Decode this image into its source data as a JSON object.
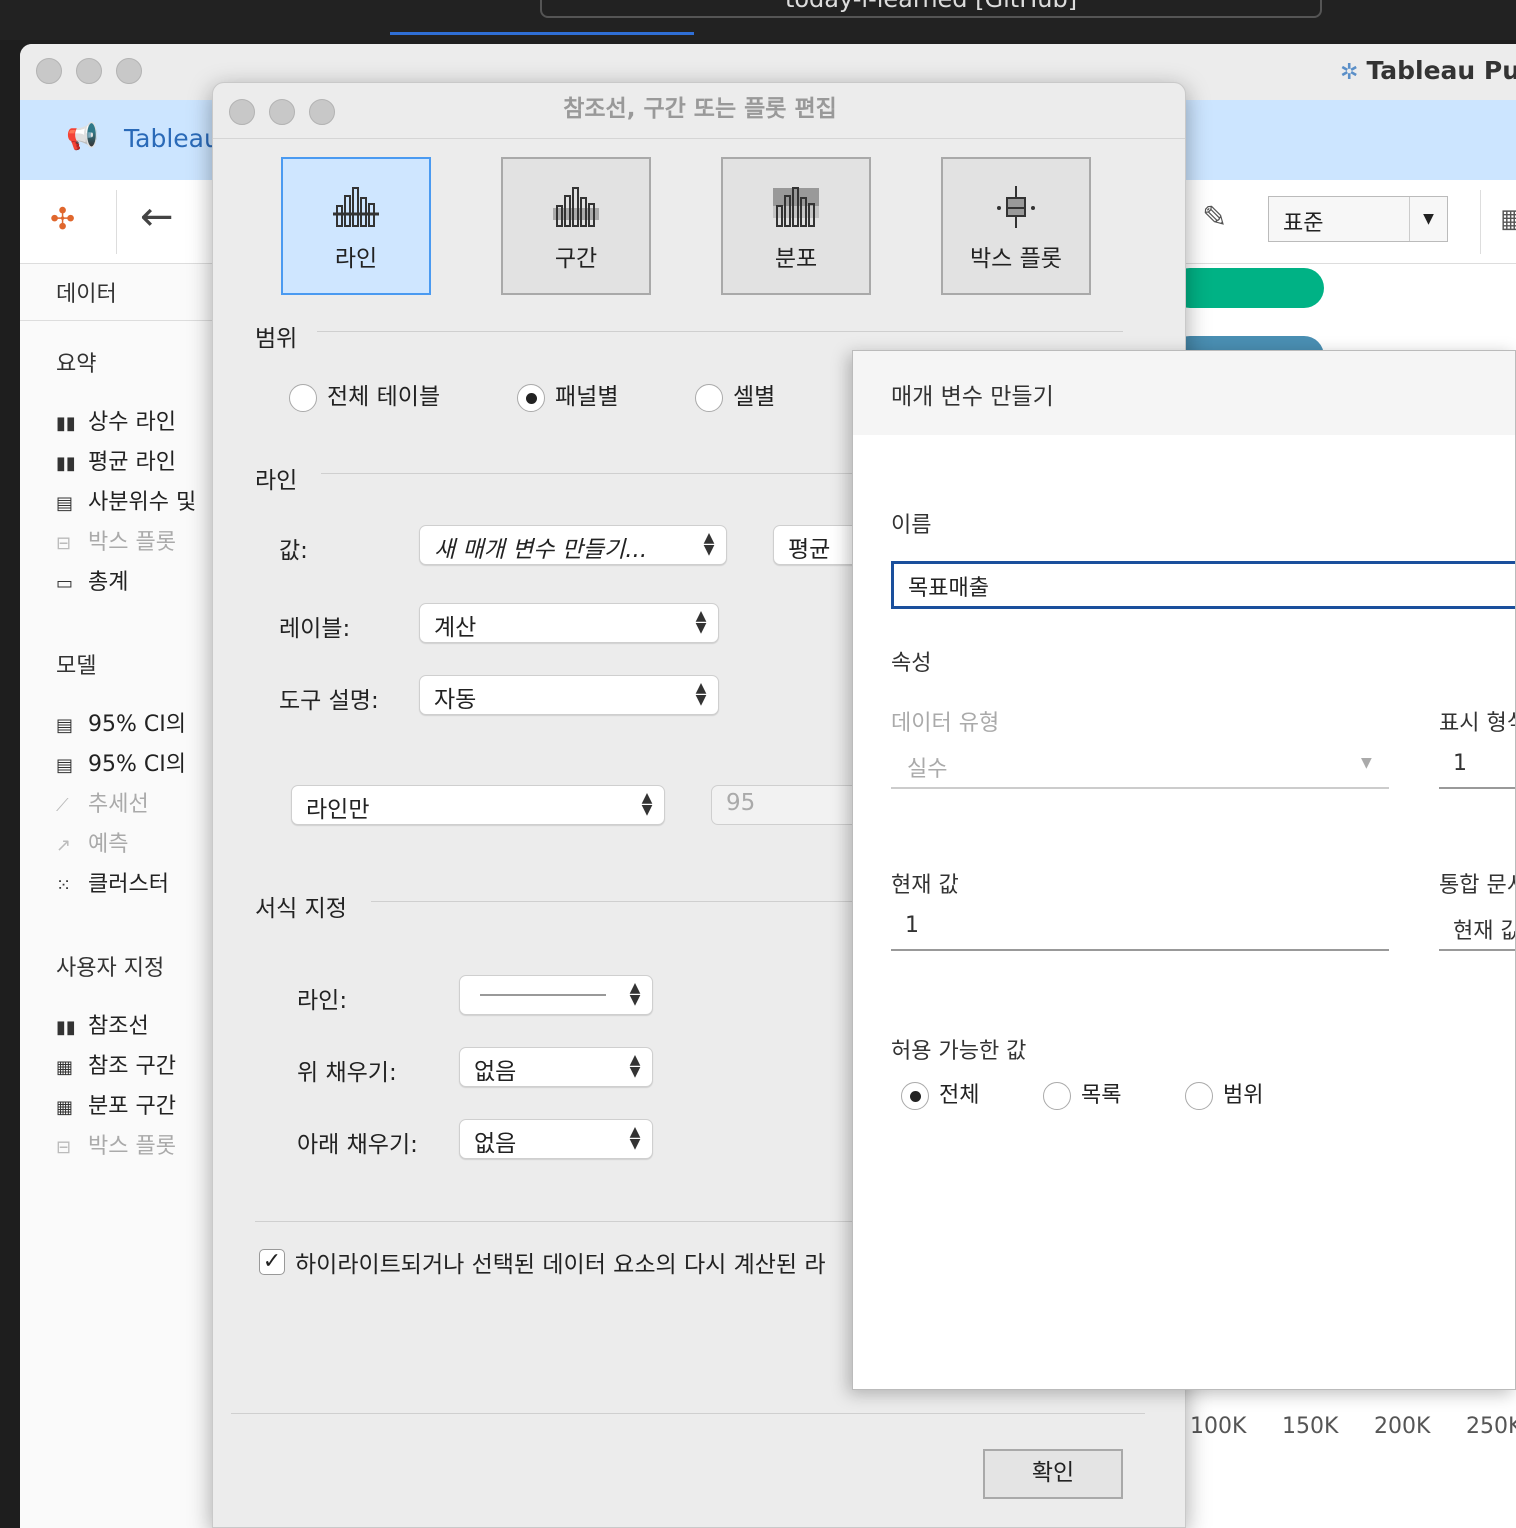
{
  "browser": {
    "url_text": "today-i-learned [GitHub]"
  },
  "main_window": {
    "app_title": "Tableau Public",
    "banner_text": "Tableau",
    "toolbar": {
      "view_select": "표준"
    },
    "axis_ticks": [
      "100K",
      "150K",
      "200K",
      "250K"
    ]
  },
  "left_pane": {
    "tab_label": "데이터",
    "sections": [
      {
        "title": "요약",
        "items": [
          {
            "label": "상수 라인",
            "icon": "▮▮",
            "enabled": true
          },
          {
            "label": "평균 라인",
            "icon": "▮▮",
            "enabled": true
          },
          {
            "label": "사분위수 및",
            "icon": "▤",
            "enabled": true
          },
          {
            "label": "박스 플롯",
            "icon": "⊟",
            "enabled": false
          },
          {
            "label": "총계",
            "icon": "▭",
            "enabled": true
          }
        ]
      },
      {
        "title": "모델",
        "items": [
          {
            "label": "95% CI의",
            "icon": "▤",
            "enabled": true
          },
          {
            "label": "95% CI의",
            "icon": "▤",
            "enabled": true
          },
          {
            "label": "추세선",
            "icon": "⟋",
            "enabled": false
          },
          {
            "label": "예측",
            "icon": "↗",
            "enabled": false
          },
          {
            "label": "클러스터",
            "icon": "⁙",
            "enabled": true
          }
        ]
      },
      {
        "title": "사용자 지정",
        "items": [
          {
            "label": "참조선",
            "icon": "▮▮",
            "enabled": true
          },
          {
            "label": "참조 구간",
            "icon": "▦",
            "enabled": true
          },
          {
            "label": "분포 구간",
            "icon": "▦",
            "enabled": true
          },
          {
            "label": "박스 플롯",
            "icon": "⊟",
            "enabled": false
          }
        ]
      }
    ]
  },
  "ref_dialog": {
    "title": "참조선, 구간 또는 플롯 편집",
    "types": [
      "라인",
      "구간",
      "분포",
      "박스 플롯"
    ],
    "scope": {
      "title": "범위",
      "options": [
        "전체 테이블",
        "패널별",
        "셀별"
      ],
      "selected": "패널별"
    },
    "line": {
      "title": "라인",
      "value_label": "값:",
      "value": "새 매개 변수 만들기...",
      "aggregation": "평균",
      "label_label": "레이블:",
      "label_value": "계산",
      "tooltip_label": "도구 설명:",
      "tooltip_value": "자동",
      "line_mode": "라인만",
      "confidence": "95"
    },
    "format": {
      "title": "서식 지정",
      "line_label": "라인:",
      "fill_above_label": "위 채우기:",
      "fill_above": "없음",
      "fill_below_label": "아래 채우기:",
      "fill_below": "없음"
    },
    "recalc_checkbox": "하이라이트되거나 선택된 데이터 요소의 다시 계산된 라",
    "ok": "확인"
  },
  "param_dialog": {
    "title": "매개 변수 만들기",
    "name_label": "이름",
    "name_value": "목표매출",
    "properties_label": "속성",
    "data_type_label": "데이터 유형",
    "data_type_value": "실수",
    "display_format_label": "표시 형식",
    "display_format_value": "1",
    "current_value_label": "현재 값",
    "current_value": "1",
    "workbook_open_label": "통합 문서",
    "workbook_open_value": "현재 값",
    "allowable_label": "허용 가능한 값",
    "allowable_options": [
      "전체",
      "목록",
      "범위"
    ],
    "allowable_selected": "전체"
  },
  "colors": {
    "accent": "#4a9af1",
    "banner": "#cce5ff",
    "pill_green": "#00b285",
    "pill_blue": "#4a8fb3",
    "input_focus": "#1a4f9c"
  }
}
